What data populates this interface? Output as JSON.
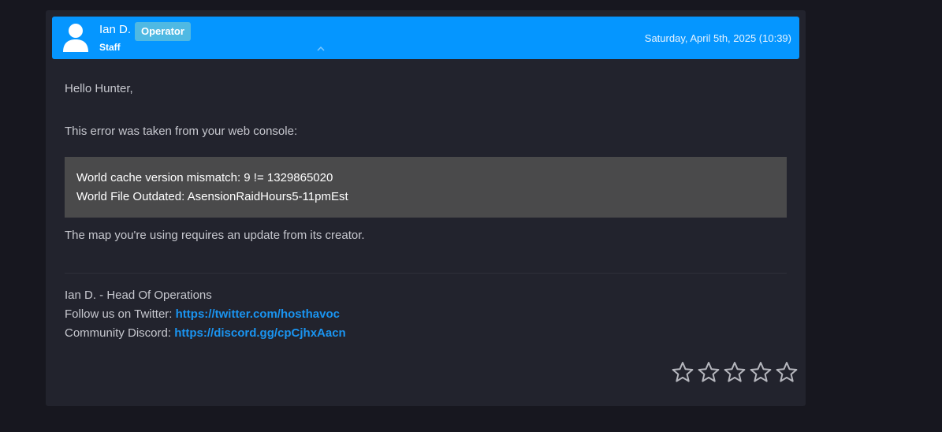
{
  "reply": {
    "author_name": "Ian D.",
    "role_badge": "Operator",
    "author_role": "Staff",
    "date": "Saturday, April 5th, 2025 (10:39)"
  },
  "message": {
    "greeting": "Hello Hunter,",
    "intro": "This error was taken from your web console:",
    "code_lines": [
      "World cache version mismatch: 9 != 1329865020",
      "World File Outdated: AsensionRaidHours5-11pmEst"
    ],
    "outro": "The map you're using requires an update from its creator."
  },
  "signature": {
    "line1": "Ian D. - Head Of Operations",
    "twitter_label": "Follow us on Twitter: ",
    "twitter_link": "https://twitter.com/hosthavoc",
    "discord_label": "Community Discord: ",
    "discord_link": "https://discord.gg/cpCjhxAacn"
  },
  "rating": {
    "max_stars": 5,
    "selected": 0,
    "star_icon": "star-outline-icon"
  },
  "colors": {
    "header_bg": "#0596ff",
    "badge_bg": "#4fb9e3",
    "panel_bg": "#22232d",
    "page_bg": "#17171f",
    "code_bg": "#4a4a4b",
    "link": "#1a94f0"
  }
}
